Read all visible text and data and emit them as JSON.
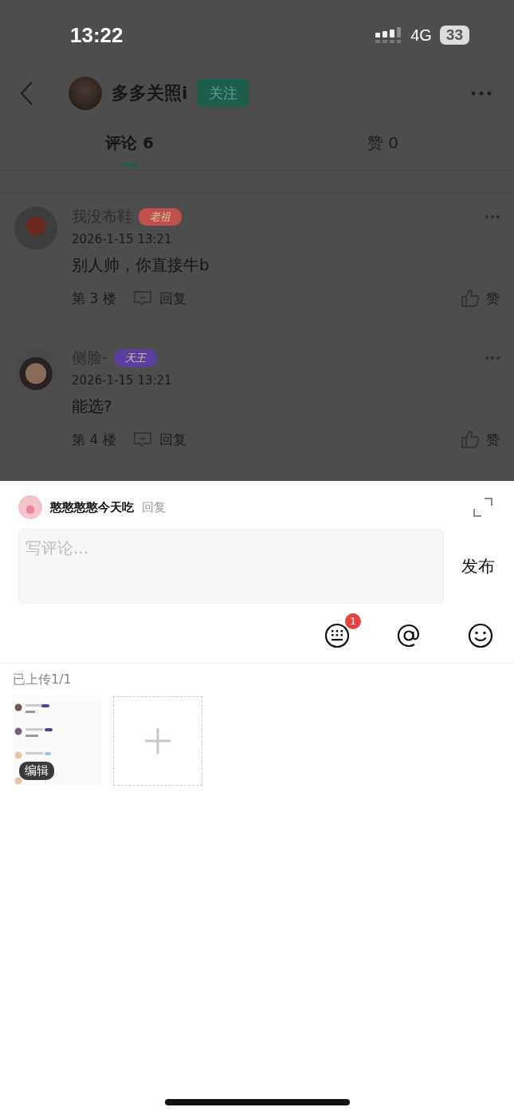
{
  "status_bar": {
    "time": "13:22",
    "network": "4G",
    "battery": "33"
  },
  "header": {
    "title": "多多关照i",
    "follow_button": "关注"
  },
  "tabs": [
    {
      "label": "评论 6",
      "selected": true
    },
    {
      "label": "赞 0",
      "selected": false
    }
  ],
  "comments": [
    {
      "name": "我没布鞋",
      "badge": "老祖",
      "color": "#c0504d",
      "date": "2026-1-15 13:21",
      "text": "别人帅，你直接牛b",
      "floor": "第 3 楼",
      "reply": "回复",
      "like": "赞"
    },
    {
      "name": "侧脸-",
      "badge": "天王",
      "color": "#5b3fa0",
      "date": "2026-1-15 13:21",
      "text": "能选?",
      "floor": "第 4 楼",
      "reply": "回复",
      "like": "赞"
    }
  ],
  "reply_sheet": {
    "user": "憨憨憨憨今天吃",
    "action": "回复",
    "placeholder": "写评论...",
    "submit": "发布",
    "keyboard_badge": "1",
    "upload_label": "已上传1/1",
    "thumbnail": {
      "kind": "picture",
      "edit_label": "编辑"
    }
  }
}
